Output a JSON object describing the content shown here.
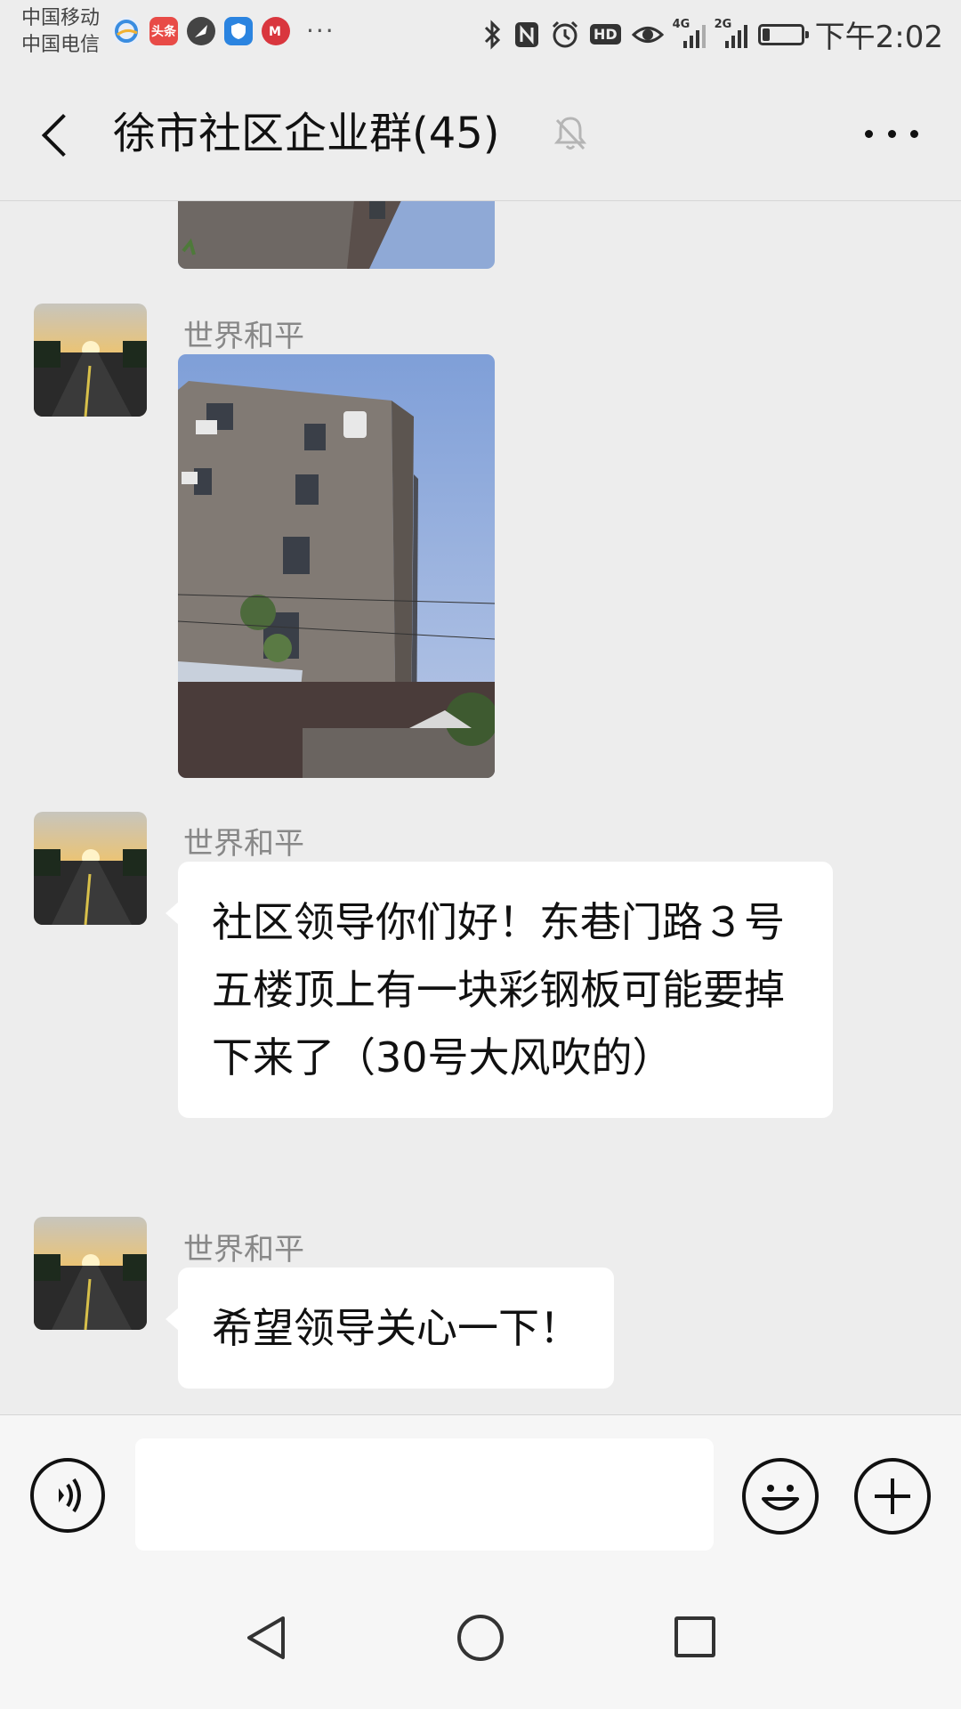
{
  "status_bar": {
    "carrier1": "中国移动",
    "carrier2": "中国电信",
    "app_badge_toutiao": "头条",
    "net_4g": "4G",
    "net_2g": "2G",
    "hd": "HD",
    "battery_level": 0.2,
    "time": "下午2:02",
    "more": "···"
  },
  "header": {
    "title": "徐市社区企业群(45)",
    "muted": true
  },
  "messages": [
    {
      "type": "image",
      "sender": "",
      "desc": "partial building photo"
    },
    {
      "type": "image",
      "sender": "世界和平"
    },
    {
      "type": "text",
      "sender": "世界和平",
      "text": "社区领导你们好！东巷门路３号五楼顶上有一块彩钢板可能要掉下来了（30号大风吹的）"
    },
    {
      "type": "text",
      "sender": "世界和平",
      "text": "希望领导关心一下！"
    }
  ],
  "input": {
    "placeholder": "",
    "value": ""
  },
  "colors": {
    "background": "#ededed",
    "bubble": "#ffffff",
    "sender_name": "#888888"
  }
}
